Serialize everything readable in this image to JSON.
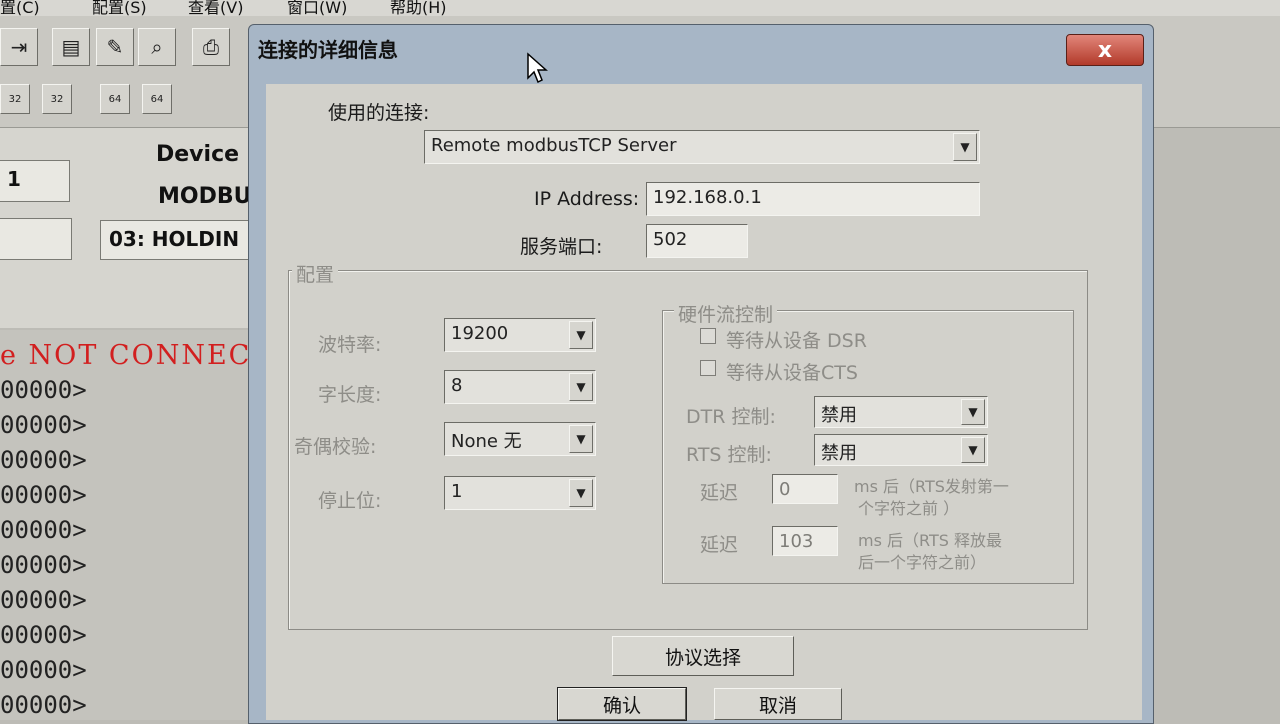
{
  "background_app": {
    "menu": [
      "置(C)",
      "配置(S)",
      "查看(V)",
      "窗口(W)",
      "帮助(H)"
    ],
    "device_label": "Device",
    "modbus_label": "MODBU",
    "field_1": "1",
    "function_field": "03: HOLDIN",
    "not_connected": "e NOT CONNEC",
    "data_rows": [
      "00000>",
      "00000>",
      "00000>",
      "00000>",
      "00000>",
      "00000>",
      "00000>",
      "00000>",
      "00000>",
      "00000>"
    ]
  },
  "dialog": {
    "title": "连接的详细信息",
    "close_label": "x",
    "connection_label": "使用的连接:",
    "connection_value": "Remote modbusTCP Server",
    "ip_label": "IP Address:",
    "ip_value": "192.168.0.1",
    "port_label": "服务端口:",
    "port_value": "502",
    "config": {
      "legend": "配置",
      "baud_label": "波特率:",
      "baud_value": "19200",
      "word_length_label": "字长度:",
      "word_length_value": "8",
      "parity_label": "奇偶校验:",
      "parity_value": "None 无",
      "stop_bits_label": "停止位:",
      "stop_bits_value": "1"
    },
    "flow": {
      "legend": "硬件流控制",
      "wait_dsr": "等待从设备 DSR",
      "wait_cts": "等待从设备CTS",
      "dtr_label": "DTR 控制:",
      "dtr_value": "禁用",
      "rts_label": "RTS 控制:",
      "rts_value": "禁用",
      "delay_label_1": "延迟",
      "delay_value_1": "0",
      "delay_note_1a": "ms 后（RTS发射第一",
      "delay_note_1b": "个字符之前 ）",
      "delay_label_2": "延迟",
      "delay_value_2": "103",
      "delay_note_2a": "ms 后（RTS 释放最",
      "delay_note_2b": "后一个字符之前）"
    },
    "protocol_button": "协议选择",
    "ok_button": "确认",
    "cancel_button": "取消"
  },
  "icons": [
    "connect-icon",
    "monitor-icon",
    "edit-icon",
    "search-icon",
    "print-icon"
  ],
  "colors": {
    "not_connected": "#d21f1f",
    "dialog_frame": "#a7b6c6",
    "close_button": "#c4493a"
  }
}
